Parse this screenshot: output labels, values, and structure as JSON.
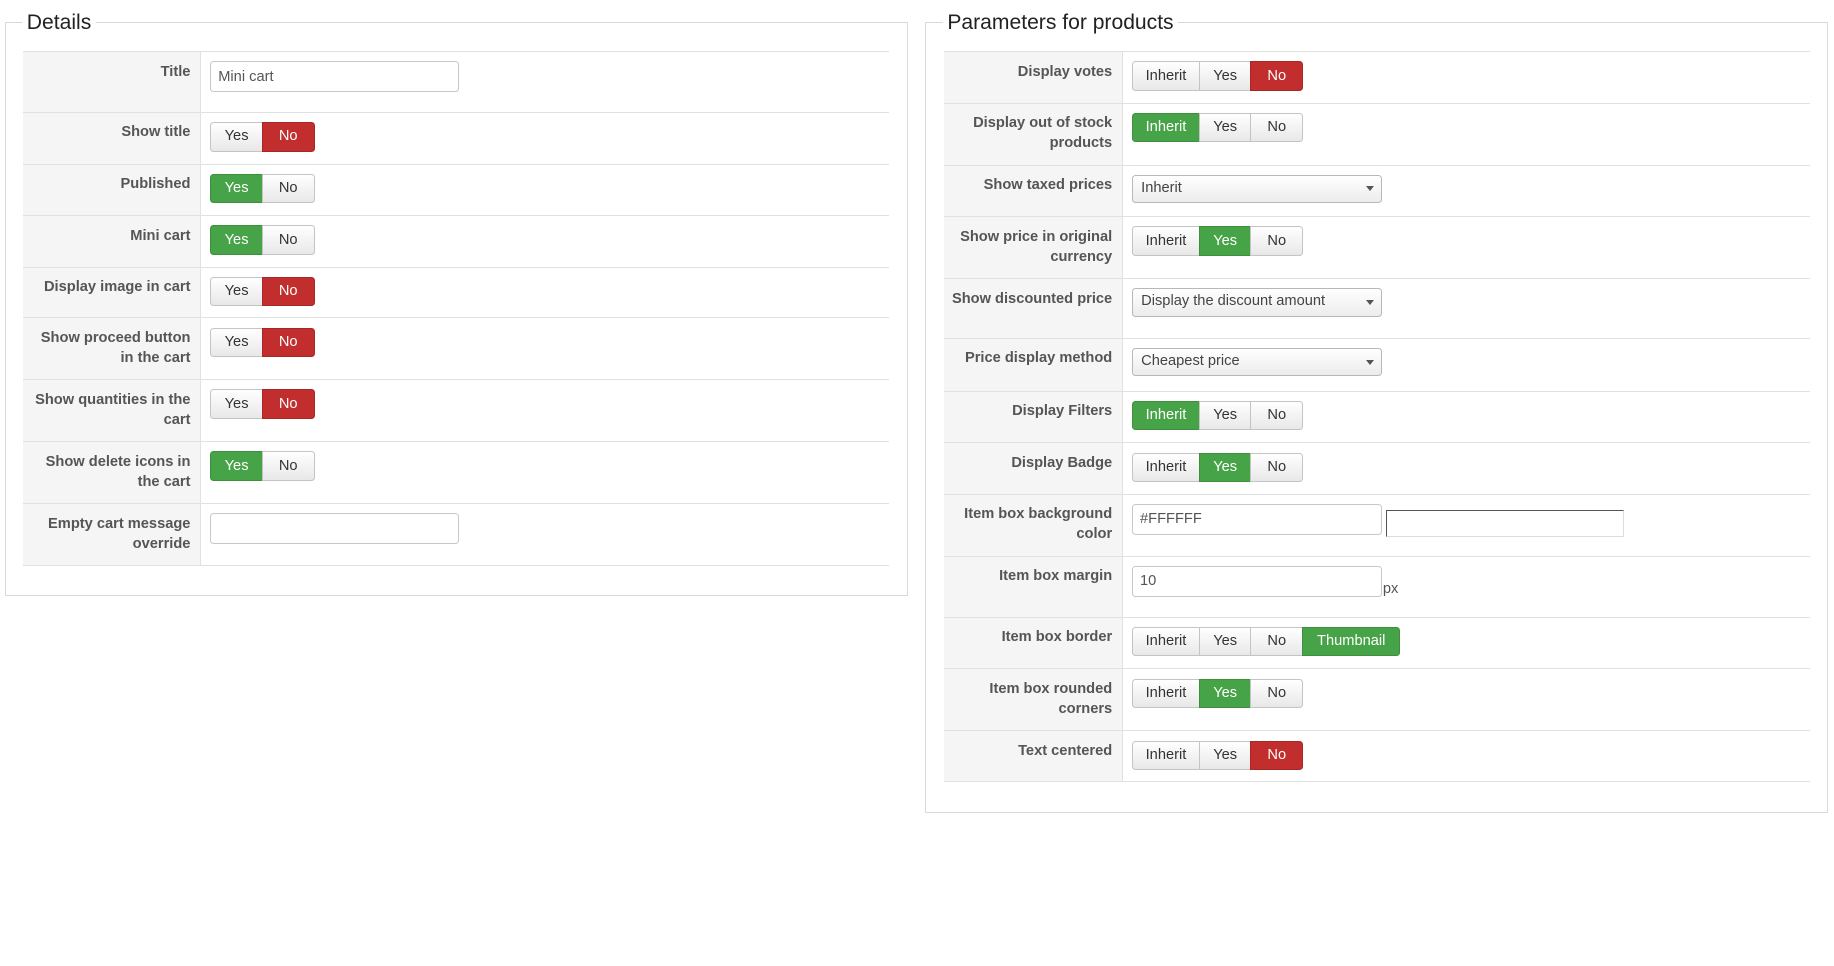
{
  "details": {
    "legend": "Details",
    "rows": [
      {
        "label": "Title",
        "type": "text",
        "value": "Mini cart"
      },
      {
        "label": "Show title",
        "type": "yesno",
        "yes": "Yes",
        "no": "No",
        "selected": "no"
      },
      {
        "label": "Published",
        "type": "yesno",
        "yes": "Yes",
        "no": "No",
        "selected": "yes"
      },
      {
        "label": "Mini cart",
        "type": "yesno",
        "yes": "Yes",
        "no": "No",
        "selected": "yes"
      },
      {
        "label": "Display image in cart",
        "type": "yesno",
        "yes": "Yes",
        "no": "No",
        "selected": "no"
      },
      {
        "label": "Show proceed button in the cart",
        "type": "yesno",
        "yes": "Yes",
        "no": "No",
        "selected": "no"
      },
      {
        "label": "Show quantities in the cart",
        "type": "yesno",
        "yes": "Yes",
        "no": "No",
        "selected": "no"
      },
      {
        "label": "Show delete icons in the cart",
        "type": "yesno",
        "yes": "Yes",
        "no": "No",
        "selected": "yes"
      },
      {
        "label": "Empty cart message override",
        "type": "text",
        "value": ""
      }
    ]
  },
  "params": {
    "legend": "Parameters for products",
    "inherit_label": "Inherit",
    "yes_label": "Yes",
    "no_label": "No",
    "rows": [
      {
        "label": "Display votes",
        "type": "tri",
        "selected": "no"
      },
      {
        "label": "Display out of stock products",
        "type": "tri",
        "selected": "inherit"
      },
      {
        "label": "Show taxed prices",
        "type": "select",
        "value": "Inherit"
      },
      {
        "label": "Show price in original currency",
        "type": "tri",
        "selected": "yes"
      },
      {
        "label": "Show discounted price",
        "type": "select",
        "value": "Display the discount amount"
      },
      {
        "label": "Price display method",
        "type": "select",
        "value": "Cheapest price"
      },
      {
        "label": "Display Filters",
        "type": "tri",
        "selected": "inherit"
      },
      {
        "label": "Display Badge",
        "type": "tri",
        "selected": "yes"
      },
      {
        "label": "Item box background color",
        "type": "color",
        "value": "#FFFFFF"
      },
      {
        "label": "Item box margin",
        "type": "number",
        "value": "10",
        "unit": "px"
      },
      {
        "label": "Item box border",
        "type": "quad",
        "extra": "Thumbnail",
        "selected": "thumbnail"
      },
      {
        "label": "Item box rounded corners",
        "type": "tri",
        "selected": "yes"
      },
      {
        "label": "Text centered",
        "type": "tri",
        "selected": "no"
      }
    ]
  },
  "colors": {
    "green": "#47a347",
    "red": "#c22d2d"
  }
}
